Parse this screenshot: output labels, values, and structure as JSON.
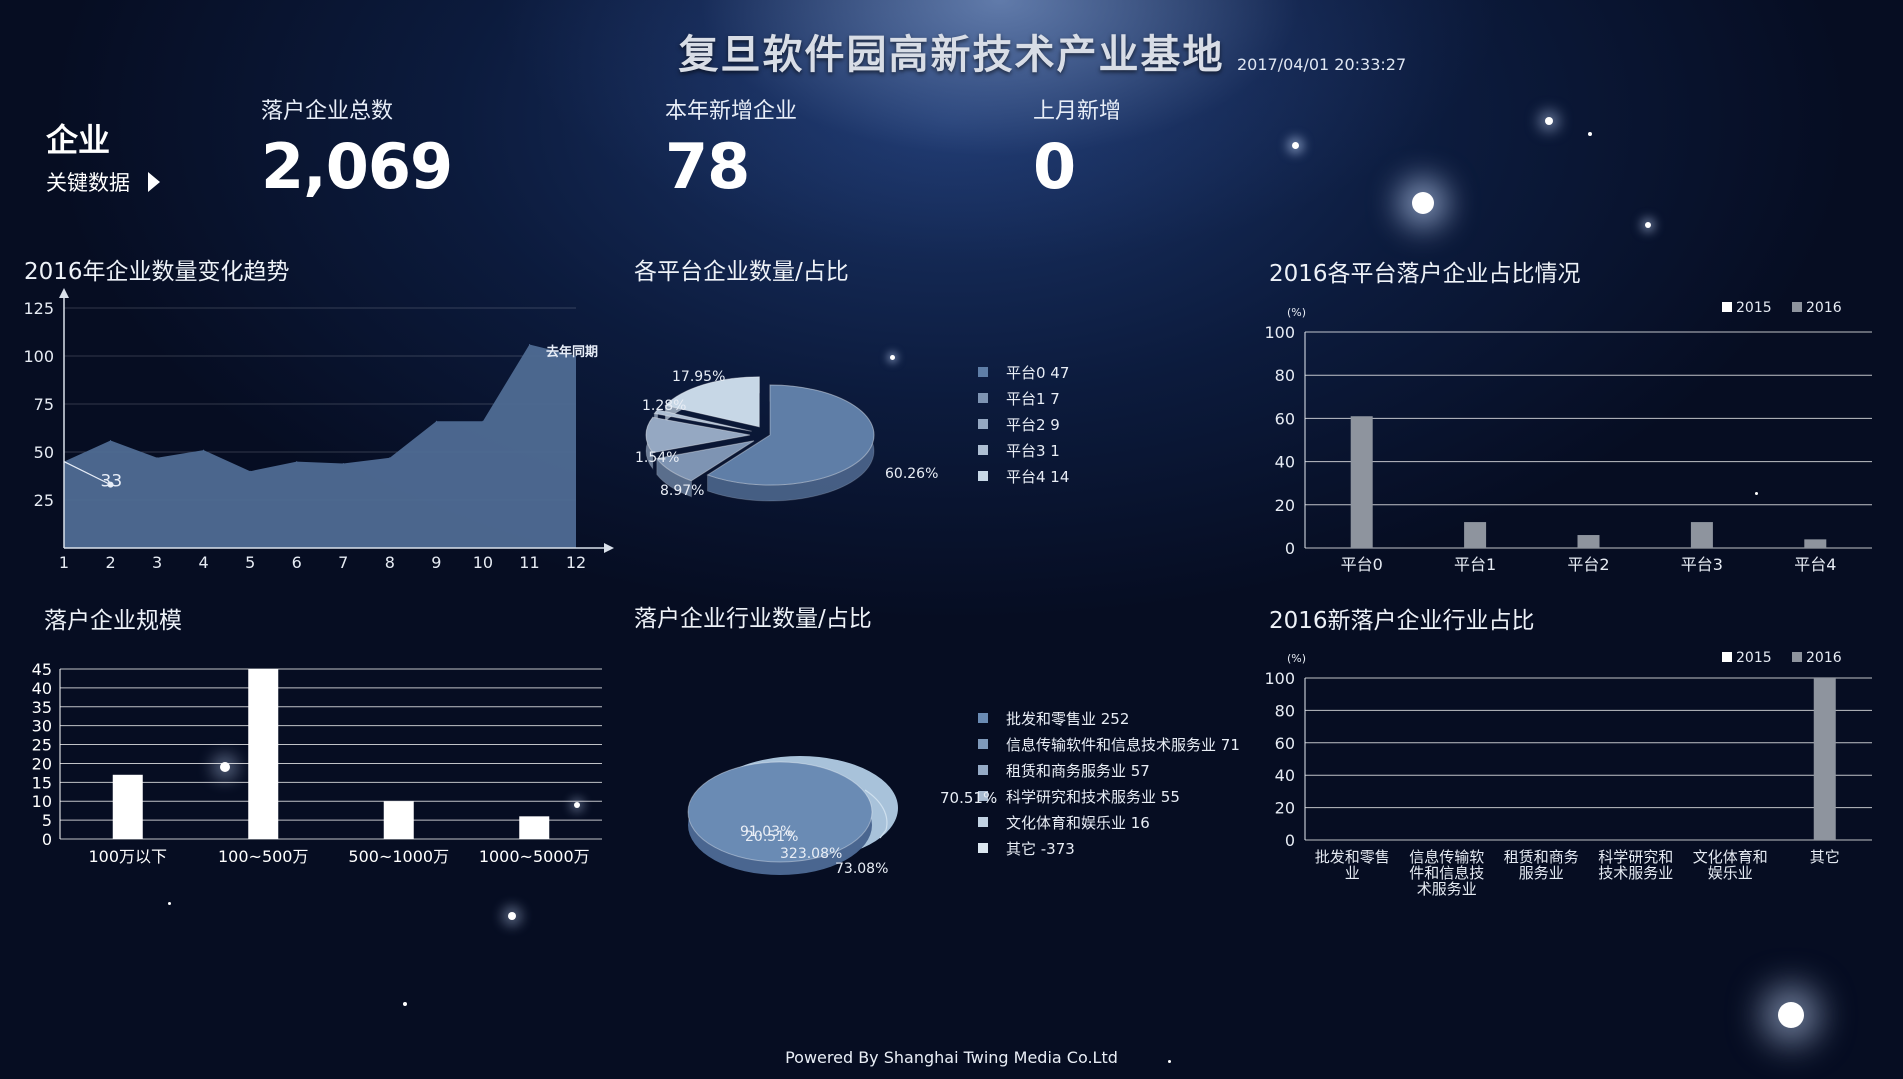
{
  "header": {
    "title": "复旦软件园高新技术产业基地",
    "datetime": "2017/04/01 20:33:27"
  },
  "kpi": {
    "section_title": "企业",
    "section_link": "关键数据",
    "items": [
      {
        "label": "落户企业总数",
        "value": "2,069"
      },
      {
        "label": "本年新增企业",
        "value": "78"
      },
      {
        "label": "上月新增",
        "value": "0"
      }
    ]
  },
  "panels": {
    "trend_title": "2016年企业数量变化趋势",
    "platform_pie_title": "各平台企业数量/占比",
    "platform_bar_title": "2016各平台落户企业占比情况",
    "scale_title": "落户企业规模",
    "industry_pie_title": "落户企业行业数量/占比",
    "industry_bar_title": "2016新落户企业行业占比"
  },
  "footer": "Powered By Shanghai Twing Media Co.Ltd",
  "colors": {
    "area": "#4f6c94",
    "bar_gray": "#8e949e",
    "bar_white": "#ffffff",
    "pie_main": "#5f7ea7",
    "pie_light": "#b9d0e3"
  },
  "chart_data": [
    {
      "id": "trend",
      "type": "area",
      "x": [
        1,
        2,
        3,
        4,
        5,
        6,
        7,
        8,
        9,
        10,
        11,
        12
      ],
      "values": [
        45,
        56,
        47,
        51,
        40,
        45,
        44,
        47,
        66,
        66,
        106,
        100
      ],
      "ylim": [
        0,
        125
      ],
      "yticks": [
        25,
        50,
        75,
        100,
        125
      ],
      "annotations": [
        {
          "text": "去年同期"
        },
        {
          "text": "33",
          "x": 2,
          "y": 33
        }
      ],
      "compare_line": [
        {
          "x": 1,
          "y": 45
        },
        {
          "x": 2,
          "y": 33
        }
      ]
    },
    {
      "id": "platform_pie",
      "type": "pie",
      "slices": [
        {
          "label": "平台0",
          "count": "47",
          "pct": "60.26%",
          "value": 60.26
        },
        {
          "label": "平台1",
          "count": "7",
          "pct": "8.97%",
          "value": 8.97
        },
        {
          "label": "平台2",
          "count": "9",
          "pct": "1.54%",
          "value": 11.54
        },
        {
          "label": "平台3",
          "count": "1",
          "pct": "1.28%",
          "value": 1.28
        },
        {
          "label": "平台4",
          "count": "14",
          "pct": "17.95%",
          "value": 17.95
        }
      ]
    },
    {
      "id": "platform_bar",
      "type": "bar",
      "unit": "(%)",
      "categories": [
        "平台0",
        "平台1",
        "平台2",
        "平台3",
        "平台4"
      ],
      "ylim": [
        0,
        100
      ],
      "yticks": [
        0,
        20,
        40,
        60,
        80,
        100
      ],
      "series": [
        {
          "name": "2015",
          "values": [
            0,
            0,
            0,
            0,
            0
          ]
        },
        {
          "name": "2016",
          "values": [
            61,
            12,
            6,
            12,
            4
          ]
        }
      ],
      "legend": "top-right"
    },
    {
      "id": "scale",
      "type": "bar",
      "categories": [
        "100万以下",
        "100~500万",
        "500~1000万",
        "1000~5000万"
      ],
      "values": [
        17,
        45,
        10,
        6
      ],
      "ylim": [
        0,
        45
      ],
      "yticks": [
        0,
        5,
        10,
        15,
        20,
        25,
        30,
        35,
        40,
        45
      ]
    },
    {
      "id": "industry_pie",
      "type": "pie",
      "slices": [
        {
          "label": "批发和零售业",
          "count": "252"
        },
        {
          "label": "信息传输软件和信息技术服务业",
          "count": "71"
        },
        {
          "label": "租赁和商务服务业",
          "count": "57"
        },
        {
          "label": "科学研究和技术服务业",
          "count": "55"
        },
        {
          "label": "文化体育和娱乐业",
          "count": "16"
        },
        {
          "label": "其它",
          "count": "-373"
        }
      ],
      "pct_labels": [
        "91.03%",
        "20.51%",
        "323.08%",
        "73.08%",
        "70.51%"
      ]
    },
    {
      "id": "industry_bar",
      "type": "bar",
      "unit": "(%)",
      "categories": [
        "批发和零售业",
        "信息传输软件和信息技术服务业",
        "租赁和商务服务业",
        "科学研究和技术服务业",
        "文化体育和娱乐业",
        "其它"
      ],
      "category_lines": [
        [
          "批发和零售",
          "业"
        ],
        [
          "信息传输软",
          "件和信息技",
          "术服务业"
        ],
        [
          "租赁和商务",
          "服务业"
        ],
        [
          "科学研究和",
          "技术服务业"
        ],
        [
          "文化体育和",
          "娱乐业"
        ],
        [
          "其它"
        ]
      ],
      "ylim": [
        0,
        100
      ],
      "yticks": [
        0,
        20,
        40,
        60,
        80,
        100
      ],
      "series": [
        {
          "name": "2015",
          "values": [
            0,
            0,
            0,
            0,
            0,
            0
          ]
        },
        {
          "name": "2016",
          "values": [
            0,
            0,
            0,
            0,
            0,
            100
          ]
        }
      ],
      "legend": "top-right"
    }
  ]
}
